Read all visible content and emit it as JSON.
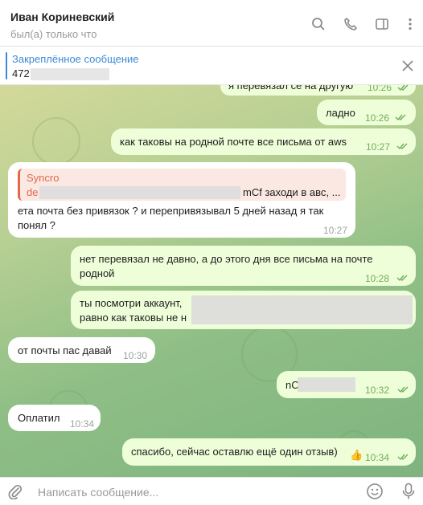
{
  "header": {
    "name": "Иван Кориневский",
    "status": "был(а) только что"
  },
  "pinned": {
    "title": "Закреплённое сообщение",
    "text": "472"
  },
  "messages": [
    {
      "text": "я перевязал се на другую",
      "time": "10:26"
    },
    {
      "text": "ладно",
      "time": "10:26"
    },
    {
      "text": "как таковы на родной почте все письма от aws",
      "time": "10:27"
    },
    {
      "reply_name": "Syncro",
      "reply_prefix": "de",
      "reply_suffix": "mCf заходи в авс, ...",
      "line1": "ета почта без привязок ? и перепривязывал 5 дней назад я так",
      "line2": "понял ?",
      "time": "10:27"
    },
    {
      "line1": "нет перевязал не давно, а до этого дня все письма на почте",
      "line2": "родной",
      "time": "10:28"
    },
    {
      "line1": "ты посмотри аккаунт,",
      "line2": "равно как таковы не н",
      "time": ""
    },
    {
      "text": "от почты пас давай",
      "time": "10:30"
    },
    {
      "text": "nC",
      "time": "10:32"
    },
    {
      "text": "Оплатил",
      "time": "10:34"
    },
    {
      "text": "спасибо, сейчас оставлю ещё один отзыв)",
      "emoji": "👍",
      "time": "10:34"
    }
  ],
  "composer": {
    "placeholder": "Написать сообщение..."
  },
  "icons": [
    "search-icon",
    "phone-icon",
    "sidebar-icon",
    "more-icon",
    "close-icon",
    "attach-icon",
    "emoji-icon",
    "mic-icon"
  ]
}
